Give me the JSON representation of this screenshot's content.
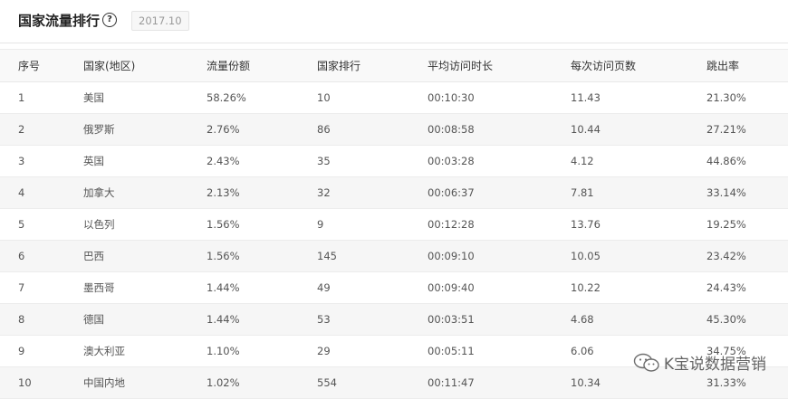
{
  "header": {
    "title": "国家流量排行",
    "help_symbol": "?",
    "date": "2017.10"
  },
  "table": {
    "columns": [
      "序号",
      "国家(地区)",
      "流量份额",
      "国家排行",
      "平均访问时长",
      "每次访问页数",
      "跳出率"
    ],
    "rows": [
      [
        "1",
        "美国",
        "58.26%",
        "10",
        "00:10:30",
        "11.43",
        "21.30%"
      ],
      [
        "2",
        "俄罗斯",
        "2.76%",
        "86",
        "00:08:58",
        "10.44",
        "27.21%"
      ],
      [
        "3",
        "英国",
        "2.43%",
        "35",
        "00:03:28",
        "4.12",
        "44.86%"
      ],
      [
        "4",
        "加拿大",
        "2.13%",
        "32",
        "00:06:37",
        "7.81",
        "33.14%"
      ],
      [
        "5",
        "以色列",
        "1.56%",
        "9",
        "00:12:28",
        "13.76",
        "19.25%"
      ],
      [
        "6",
        "巴西",
        "1.56%",
        "145",
        "00:09:10",
        "10.05",
        "23.42%"
      ],
      [
        "7",
        "墨西哥",
        "1.44%",
        "49",
        "00:09:40",
        "10.22",
        "24.43%"
      ],
      [
        "8",
        "德国",
        "1.44%",
        "53",
        "00:03:51",
        "4.68",
        "45.30%"
      ],
      [
        "9",
        "澳大利亚",
        "1.10%",
        "29",
        "00:05:11",
        "6.06",
        "34.75%"
      ],
      [
        "10",
        "中国内地",
        "1.02%",
        "554",
        "00:11:47",
        "10.34",
        "31.33%"
      ]
    ]
  },
  "watermark": {
    "text": "K宝说数据营销",
    "icon": "wechat-icon"
  }
}
